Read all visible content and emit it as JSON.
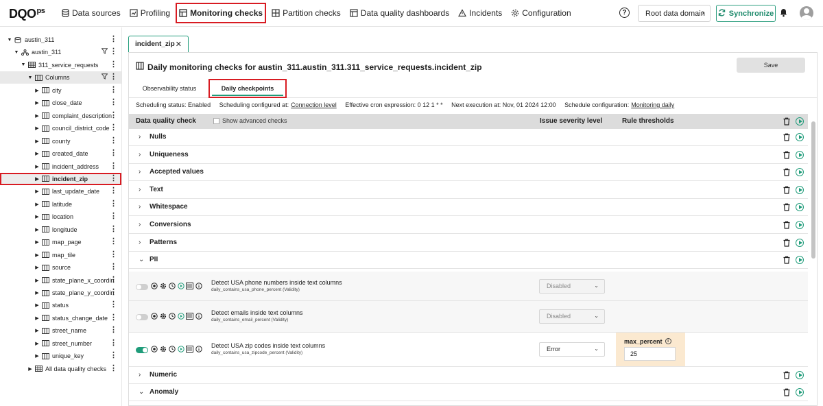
{
  "app": {
    "logo": "DQO",
    "logo_suffix": "ps"
  },
  "nav": [
    {
      "label": "Data sources",
      "icon": "database-icon",
      "active": false
    },
    {
      "label": "Profiling",
      "icon": "profiling-icon",
      "active": false
    },
    {
      "label": "Monitoring checks",
      "icon": "monitoring-icon",
      "active": true
    },
    {
      "label": "Partition checks",
      "icon": "partition-icon",
      "active": false
    },
    {
      "label": "Data quality dashboards",
      "icon": "dashboard-icon",
      "active": false
    },
    {
      "label": "Incidents",
      "icon": "warning-icon",
      "active": false
    },
    {
      "label": "Configuration",
      "icon": "gear-icon",
      "active": false
    }
  ],
  "header": {
    "help_glyph": "?",
    "domain_label": "Root data domain",
    "sync_label": "Synchronize"
  },
  "tree": [
    {
      "label": "austin_311",
      "caret": "▼",
      "icon": "database-icon",
      "filter": false
    },
    {
      "label": "austin_311",
      "caret": "▼",
      "icon": "schema-icon",
      "filter": true
    },
    {
      "label": "311_service_requests",
      "caret": "▼",
      "icon": "table-icon",
      "filter": false
    },
    {
      "label": "Columns",
      "caret": "▼",
      "icon": "columns-icon",
      "filter": true,
      "selected": true
    },
    {
      "label": "city",
      "caret": "▶",
      "icon": "column-icon"
    },
    {
      "label": "close_date",
      "caret": "▶",
      "icon": "column-icon"
    },
    {
      "label": "complaint_description",
      "caret": "▶",
      "icon": "column-icon"
    },
    {
      "label": "council_district_code",
      "caret": "▶",
      "icon": "column-icon"
    },
    {
      "label": "county",
      "caret": "▶",
      "icon": "column-icon"
    },
    {
      "label": "created_date",
      "caret": "▶",
      "icon": "column-icon"
    },
    {
      "label": "incident_address",
      "caret": "▶",
      "icon": "column-icon"
    },
    {
      "label": "incident_zip",
      "caret": "▶",
      "icon": "column-icon",
      "highlighted": true
    },
    {
      "label": "last_update_date",
      "caret": "▶",
      "icon": "column-icon"
    },
    {
      "label": "latitude",
      "caret": "▶",
      "icon": "column-icon"
    },
    {
      "label": "location",
      "caret": "▶",
      "icon": "column-icon"
    },
    {
      "label": "longitude",
      "caret": "▶",
      "icon": "column-icon"
    },
    {
      "label": "map_page",
      "caret": "▶",
      "icon": "column-icon"
    },
    {
      "label": "map_tile",
      "caret": "▶",
      "icon": "column-icon"
    },
    {
      "label": "source",
      "caret": "▶",
      "icon": "column-icon"
    },
    {
      "label": "state_plane_x_coordina",
      "caret": "▶",
      "icon": "column-icon"
    },
    {
      "label": "state_plane_y_coordina",
      "caret": "▶",
      "icon": "column-icon"
    },
    {
      "label": "status",
      "caret": "▶",
      "icon": "column-icon"
    },
    {
      "label": "status_change_date",
      "caret": "▶",
      "icon": "column-icon"
    },
    {
      "label": "street_name",
      "caret": "▶",
      "icon": "column-icon"
    },
    {
      "label": "street_number",
      "caret": "▶",
      "icon": "column-icon"
    },
    {
      "label": "unique_key",
      "caret": "▶",
      "icon": "column-icon"
    },
    {
      "label": "All data quality checks",
      "caret": "▶",
      "icon": "table-icon"
    }
  ],
  "file_tab": {
    "label": "incident_zip",
    "close": "✕"
  },
  "panel": {
    "title": "Daily monitoring checks for austin_311.austin_311.311_service_requests.incident_zip",
    "save_label": "Save",
    "tabs": [
      "Observability status",
      "Daily checkpoints"
    ],
    "scheduling_status": "Scheduling status: Enabled",
    "scheduling_configured_prefix": "Scheduling configured at:",
    "scheduling_configured_link": "Connection level",
    "cron": "Effective cron expression: 0 12 1 * *",
    "next_execution": "Next execution at: Nov, 01 2024 12:00",
    "schedule_config_prefix": "Schedule configuration:",
    "schedule_config_link": "Monitoring daily"
  },
  "table": {
    "col_check": "Data quality check",
    "show_advanced": "Show advanced checks",
    "col_severity": "Issue severity level",
    "col_thresholds": "Rule thresholds"
  },
  "categories_top": [
    {
      "name": "Nulls",
      "chev": "›"
    },
    {
      "name": "Uniqueness",
      "chev": "›"
    },
    {
      "name": "Accepted values",
      "chev": "›"
    },
    {
      "name": "Text",
      "chev": "›"
    },
    {
      "name": "Whitespace",
      "chev": "›"
    },
    {
      "name": "Conversions",
      "chev": "›"
    },
    {
      "name": "Patterns",
      "chev": "›"
    },
    {
      "name": "PII",
      "chev": "⌄"
    }
  ],
  "checks": [
    {
      "title": "Detect USA phone numbers inside text columns",
      "name": "daily_contains_usa_phone_percent (Validity)",
      "enabled": false,
      "severity": "Disabled"
    },
    {
      "title": "Detect emails inside text columns",
      "name": "daily_contains_email_percent (Validity)",
      "enabled": false,
      "severity": "Disabled"
    },
    {
      "title": "Detect USA zip codes inside text columns",
      "name": "daily_contains_usa_zipcode_percent (Validity)",
      "enabled": true,
      "severity": "Error",
      "threshold_label": "max_percent",
      "threshold_value": "25"
    }
  ],
  "categories_bottom": [
    {
      "name": "Numeric",
      "chev": "›"
    },
    {
      "name": "Anomaly",
      "chev": "⌄"
    }
  ],
  "colors": {
    "accent": "#1f9c7a",
    "highlight": "#d81b22",
    "threshold_bg": "#fbe9d0"
  }
}
